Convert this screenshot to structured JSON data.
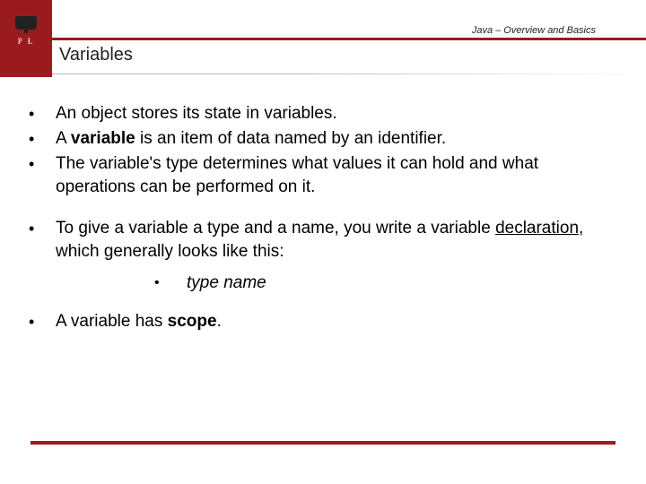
{
  "header": {
    "breadcrumb": "Java – Overview and Basics",
    "logo_letters": "P   Ł",
    "slide_title": "Variables"
  },
  "bullets": {
    "b1": "An object stores its state in variables.",
    "b2_pre": "A ",
    "b2_bold": "variable",
    "b2_post": " is an item of data named by an identifier.",
    "b3": "The variable's type determines what values it can hold and what operations can be performed on it.",
    "b4_pre": "To give a variable a type and a name, you write a variable ",
    "b4_under": "declaration",
    "b4_post": ", which generally looks like this:",
    "sub1": "type name",
    "b5_pre": "A variable has ",
    "b5_bold": "scope",
    "b5_post": "."
  }
}
